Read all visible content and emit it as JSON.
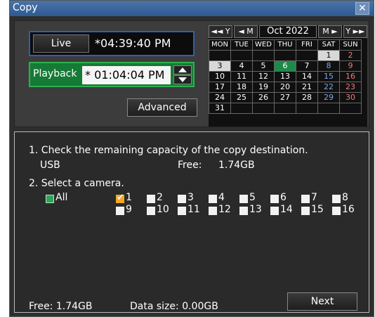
{
  "window": {
    "title": "Copy",
    "close_icon": "close-icon"
  },
  "live": {
    "label": "Live",
    "time": "*04:39:40 PM"
  },
  "playback": {
    "label": "Playback",
    "time": "* 01:04:04 PM"
  },
  "advanced_label": "Advanced",
  "calendar": {
    "nav_prev_year": "◄◄ Y",
    "nav_prev_month": "◄ M",
    "month_label": "Oct 2022",
    "nav_next_month": "M ►",
    "nav_next_year": "Y ►►",
    "days_of_week": [
      "MON",
      "TUE",
      "WED",
      "THU",
      "FRI",
      "SAT",
      "SUN"
    ],
    "weeks": [
      [
        "",
        "",
        "",
        "",
        "",
        "1",
        "2"
      ],
      [
        "3",
        "4",
        "5",
        "6",
        "7",
        "8",
        "9"
      ],
      [
        "10",
        "11",
        "12",
        "13",
        "14",
        "15",
        "16"
      ],
      [
        "17",
        "18",
        "19",
        "20",
        "21",
        "22",
        "23"
      ],
      [
        "24",
        "25",
        "26",
        "27",
        "28",
        "29",
        "30"
      ],
      [
        "31",
        "",
        "",
        "",
        "",
        "",
        ""
      ]
    ],
    "today": "6",
    "selected": [
      "1",
      "3"
    ],
    "colors": {
      "saturday": "#7aa7e8",
      "sunday": "#f07a7a",
      "today_bg": "#1e8a4a",
      "selected_bg": "#d8d8d8"
    }
  },
  "copy_steps": {
    "step1": "1. Check the remaining capacity of the copy destination.",
    "destination": "USB",
    "free_label": "Free:",
    "free_value": "1.74GB",
    "step2": "2. Select a camera.",
    "all_label": "All",
    "cameras": [
      "1",
      "2",
      "3",
      "4",
      "5",
      "6",
      "7",
      "8",
      "9",
      "10",
      "11",
      "12",
      "13",
      "14",
      "15",
      "16"
    ],
    "checked_camera": "1"
  },
  "footer": {
    "free_text": "Free:  1.74GB",
    "data_size_text": "Data size: 0.00GB",
    "next_label": "Next"
  }
}
